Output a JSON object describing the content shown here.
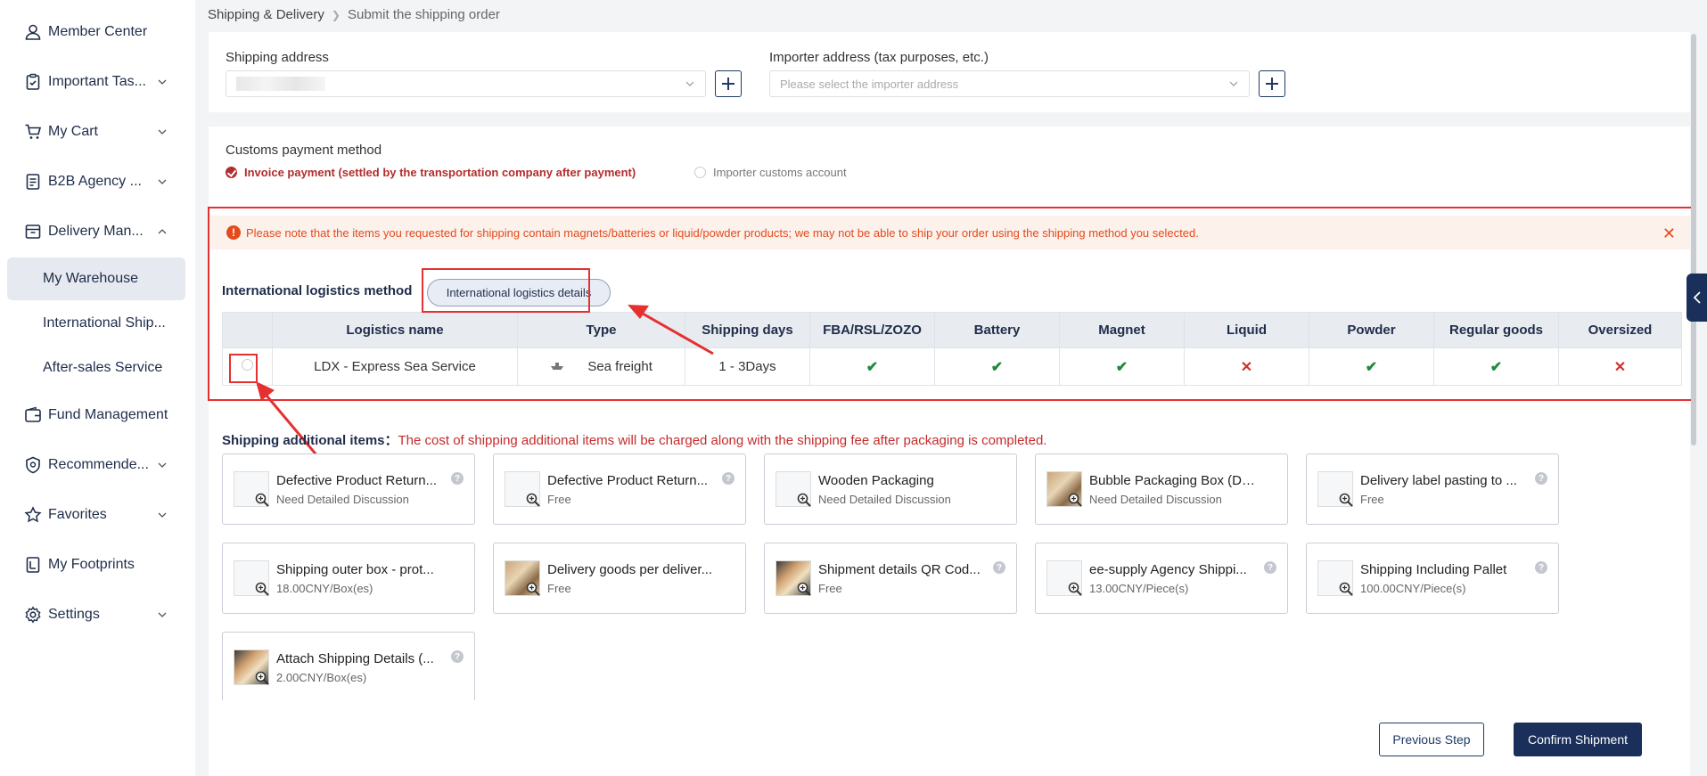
{
  "sidebar": {
    "items": [
      {
        "label": "Member Center",
        "icon": "user-icon"
      },
      {
        "label": "Important Tas...",
        "icon": "clipboard-icon"
      },
      {
        "label": "My Cart",
        "icon": "cart-icon"
      },
      {
        "label": "B2B Agency ...",
        "icon": "document-icon"
      },
      {
        "label": "Delivery Man...",
        "icon": "box-icon"
      },
      {
        "label": "Fund Management",
        "icon": "wallet-icon"
      },
      {
        "label": "Recommende...",
        "icon": "badge-icon"
      },
      {
        "label": "Favorites",
        "icon": "star-icon"
      },
      {
        "label": "My Footprints",
        "icon": "footprint-icon"
      },
      {
        "label": "Settings",
        "icon": "gear-icon"
      }
    ],
    "sub_items": [
      {
        "label": "My Warehouse"
      },
      {
        "label": "International Ship..."
      },
      {
        "label": "After-sales Service"
      }
    ]
  },
  "breadcrumb": {
    "parent": "Shipping & Delivery",
    "current": "Submit the shipping order"
  },
  "address": {
    "shipping_label": "Shipping address",
    "importer_label": "Importer address (tax purposes, etc.)",
    "importer_placeholder": "Please select the importer address"
  },
  "customs": {
    "label": "Customs payment method",
    "option1": "Invoice payment (settled by the transportation company after payment)",
    "option2": "Importer customs account"
  },
  "alert": {
    "text": "Please note that the items you requested for shipping contain magnets/batteries or liquid/powder products; we may not be able to ship your order using the shipping method you selected."
  },
  "logistics": {
    "label": "International logistics method",
    "details_button": "International logistics details",
    "headers": [
      "Logistics name",
      "Type",
      "Shipping days",
      "FBA/RSL/ZOZO",
      "Battery",
      "Magnet",
      "Liquid",
      "Powder",
      "Regular goods",
      "Oversized"
    ],
    "row": {
      "name": "LDX - Express Sea Service",
      "type": "Sea freight",
      "days": "1 - 3Days",
      "flags": [
        true,
        true,
        true,
        false,
        true,
        true,
        false
      ]
    }
  },
  "additional": {
    "title": "Shipping additional items：",
    "note": "The cost of shipping additional items will be charged along with the shipping fee after packaging is completed.",
    "items": [
      {
        "name": "Defective Product Return...",
        "price": "Need Detailed Discussion"
      },
      {
        "name": "Defective Product Return...",
        "price": "Free"
      },
      {
        "name": "Wooden Packaging",
        "price": "Need Detailed Discussion"
      },
      {
        "name": "Bubble Packaging Box (Do...",
        "price": "Need Detailed Discussion"
      },
      {
        "name": "Delivery label pasting to ...",
        "price": "Free"
      },
      {
        "name": "Shipping outer box - prot...",
        "price": "18.00CNY/Box(es)"
      },
      {
        "name": "Delivery goods per deliver...",
        "price": "Free"
      },
      {
        "name": "Shipment details QR Cod...",
        "price": "Free"
      },
      {
        "name": "ee-supply Agency Shippi...",
        "price": "13.00CNY/Piece(s)"
      },
      {
        "name": "Shipping Including Pallet",
        "price": "100.00CNY/Piece(s)"
      },
      {
        "name": "Attach Shipping Details (...",
        "price": "2.00CNY/Box(es)"
      }
    ]
  },
  "footer": {
    "prev": "Previous Step",
    "confirm": "Confirm Shipment"
  },
  "colors": {
    "brand": "#1a2f5a",
    "alert": "#e34b1b",
    "annotation": "#e5302f",
    "ok": "#1e8a3b",
    "no": "#d42f2f"
  }
}
